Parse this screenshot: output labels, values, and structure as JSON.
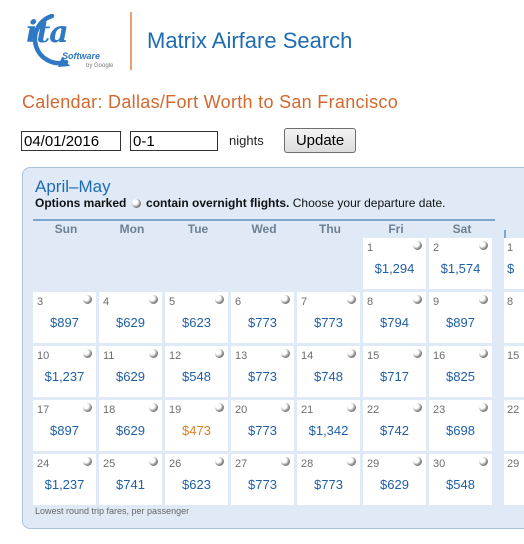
{
  "header": {
    "logo_text": "ita",
    "logo_software": "Software",
    "logo_google": "by Google",
    "app_title": "Matrix Airfare Search"
  },
  "page_title": "Calendar: Dallas/Fort Worth to San Francisco",
  "controls": {
    "date_value": "04/01/2016",
    "nights_value": "0-1",
    "nights_label": "nights",
    "update_label": "Update"
  },
  "calendar": {
    "month_title": "April–May",
    "instructions_bold_1": "Options marked",
    "instructions_bold_2": "contain overnight flights.",
    "instructions_rest": "Choose your departure date.",
    "weekdays": [
      "Sun",
      "Mon",
      "Tue",
      "Wed",
      "Thu",
      "Fri",
      "Sat"
    ],
    "weeks": [
      [
        null,
        null,
        null,
        null,
        null,
        {
          "day": "1",
          "price": "$1,294",
          "overnight": true
        },
        {
          "day": "2",
          "price": "$1,574",
          "overnight": true
        }
      ],
      [
        {
          "day": "3",
          "price": "$897",
          "overnight": true
        },
        {
          "day": "4",
          "price": "$629",
          "overnight": true
        },
        {
          "day": "5",
          "price": "$623",
          "overnight": true
        },
        {
          "day": "6",
          "price": "$773",
          "overnight": true
        },
        {
          "day": "7",
          "price": "$773",
          "overnight": true
        },
        {
          "day": "8",
          "price": "$794",
          "overnight": true
        },
        {
          "day": "9",
          "price": "$897",
          "overnight": true
        }
      ],
      [
        {
          "day": "10",
          "price": "$1,237",
          "overnight": true
        },
        {
          "day": "11",
          "price": "$629",
          "overnight": true
        },
        {
          "day": "12",
          "price": "$548",
          "overnight": true
        },
        {
          "day": "13",
          "price": "$773",
          "overnight": true
        },
        {
          "day": "14",
          "price": "$748",
          "overnight": true
        },
        {
          "day": "15",
          "price": "$717",
          "overnight": true
        },
        {
          "day": "16",
          "price": "$825",
          "overnight": true
        }
      ],
      [
        {
          "day": "17",
          "price": "$897",
          "overnight": true
        },
        {
          "day": "18",
          "price": "$629",
          "overnight": true
        },
        {
          "day": "19",
          "price": "$473",
          "overnight": true,
          "lowest": true
        },
        {
          "day": "20",
          "price": "$773",
          "overnight": true
        },
        {
          "day": "21",
          "price": "$1,342",
          "overnight": true
        },
        {
          "day": "22",
          "price": "$742",
          "overnight": true
        },
        {
          "day": "23",
          "price": "$698",
          "overnight": true
        }
      ],
      [
        {
          "day": "24",
          "price": "$1,237",
          "overnight": true
        },
        {
          "day": "25",
          "price": "$741",
          "overnight": true
        },
        {
          "day": "26",
          "price": "$623",
          "overnight": true
        },
        {
          "day": "27",
          "price": "$773",
          "overnight": true
        },
        {
          "day": "28",
          "price": "$773",
          "overnight": true
        },
        {
          "day": "29",
          "price": "$629",
          "overnight": true
        },
        {
          "day": "30",
          "price": "$548",
          "overnight": true
        }
      ]
    ],
    "footnote": "Lowest round trip fares, per passenger"
  },
  "next_month_strip": [
    {
      "day": "1",
      "price": "$"
    },
    {
      "day": "8",
      "price": ""
    },
    {
      "day": "15",
      "price": ""
    },
    {
      "day": "22",
      "price": ""
    },
    {
      "day": "29",
      "price": ""
    }
  ],
  "colors": {
    "accent_blue": "#1f6cb3",
    "title_orange": "#d3682e",
    "lowest_fare": "#d9822b",
    "panel_bg": "#dfeaf6"
  }
}
